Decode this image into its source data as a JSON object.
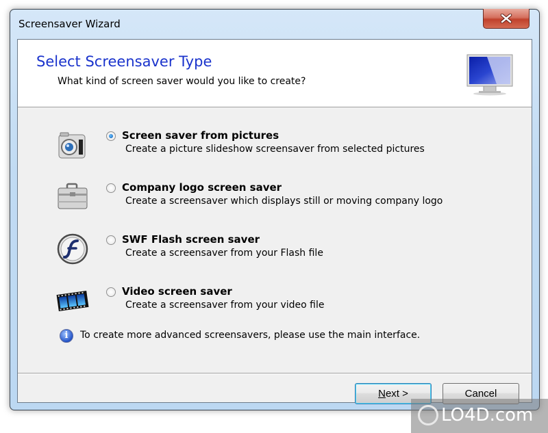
{
  "window": {
    "title": "Screensaver Wizard",
    "close_icon": "close-icon"
  },
  "header": {
    "title": "Select Screensaver Type",
    "subtitle": "What kind of screen saver would you like to create?",
    "icon": "monitor-icon"
  },
  "options": [
    {
      "icon": "camera-icon",
      "label": "Screen saver from pictures",
      "description": "Create a picture slideshow screensaver from selected pictures",
      "selected": true
    },
    {
      "icon": "briefcase-icon",
      "label": "Company logo screen saver",
      "description": "Create a screensaver which displays still or moving company logo",
      "selected": false
    },
    {
      "icon": "flash-icon",
      "label": "SWF Flash screen saver",
      "description": "Create a screensaver from your Flash file",
      "selected": false
    },
    {
      "icon": "film-strip-icon",
      "label": "Video screen saver",
      "description": "Create a screensaver from your video file",
      "selected": false
    }
  ],
  "info": {
    "icon": "info-icon",
    "text": "To create more advanced screensavers, please use the main interface."
  },
  "buttons": {
    "next_accel": "N",
    "next_rest": "ext >",
    "cancel": "Cancel"
  },
  "watermark": {
    "text": "LO4D.com"
  },
  "colors": {
    "header_title": "#1a33cc",
    "close_button": "#c0412c",
    "default_button_border": "#3c7fb1"
  }
}
